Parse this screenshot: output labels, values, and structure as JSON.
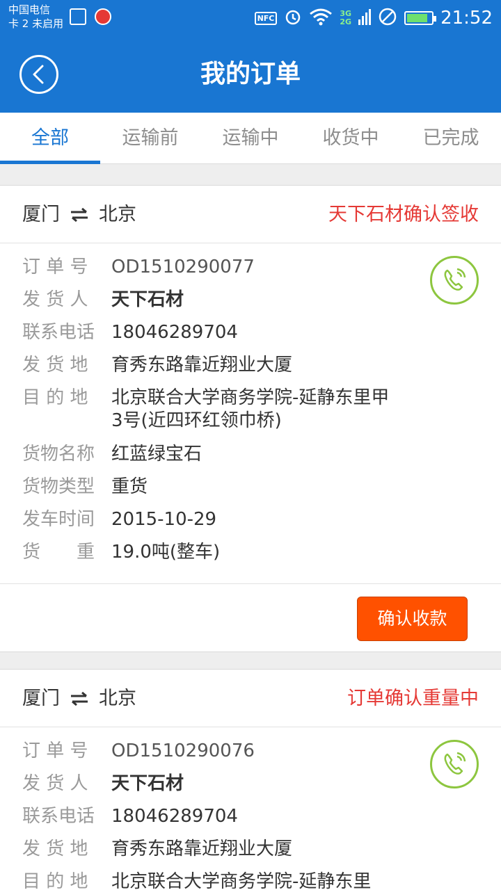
{
  "status_bar": {
    "carrier_line1": "中国电信",
    "carrier_line2": "卡 2 未启用",
    "nfc": "NFC",
    "net_3g": "3G",
    "net_2g": "2G",
    "time": "21:52",
    "battery_level": 0.85
  },
  "header": {
    "title": "我的订单"
  },
  "tabs": [
    {
      "label": "全部",
      "active": true
    },
    {
      "label": "运输前",
      "active": false
    },
    {
      "label": "运输中",
      "active": false
    },
    {
      "label": "收货中",
      "active": false
    },
    {
      "label": "已完成",
      "active": false
    }
  ],
  "labels": {
    "order_no": "订 单 号",
    "shipper": "发 货 人",
    "phone": "联系电话",
    "origin": "发 货 地",
    "destination": "目 的 地",
    "goods_name": "货物名称",
    "goods_type": "货物类型",
    "depart_time": "发车时间",
    "weight": "货　　重"
  },
  "orders": [
    {
      "from": "厦门",
      "to": "北京",
      "status": "天下石材确认签收",
      "order_no": "OD1510290077",
      "shipper": "天下石材",
      "phone": "18046289704",
      "origin": "育秀东路靠近翔业大厦",
      "destination": "北京联合大学商务学院-延静东里甲3号(近四环红领巾桥)",
      "goods_name": "红蓝绿宝石",
      "goods_type": "重货",
      "depart_time": "2015-10-29",
      "weight": "19.0吨(整车)",
      "action": "确认收款"
    },
    {
      "from": "厦门",
      "to": "北京",
      "status": "订单确认重量中",
      "order_no": "OD1510290076",
      "shipper": "天下石材",
      "phone": "18046289704",
      "origin": "育秀东路靠近翔业大厦",
      "destination": "北京联合大学商务学院-延静东里"
    }
  ]
}
